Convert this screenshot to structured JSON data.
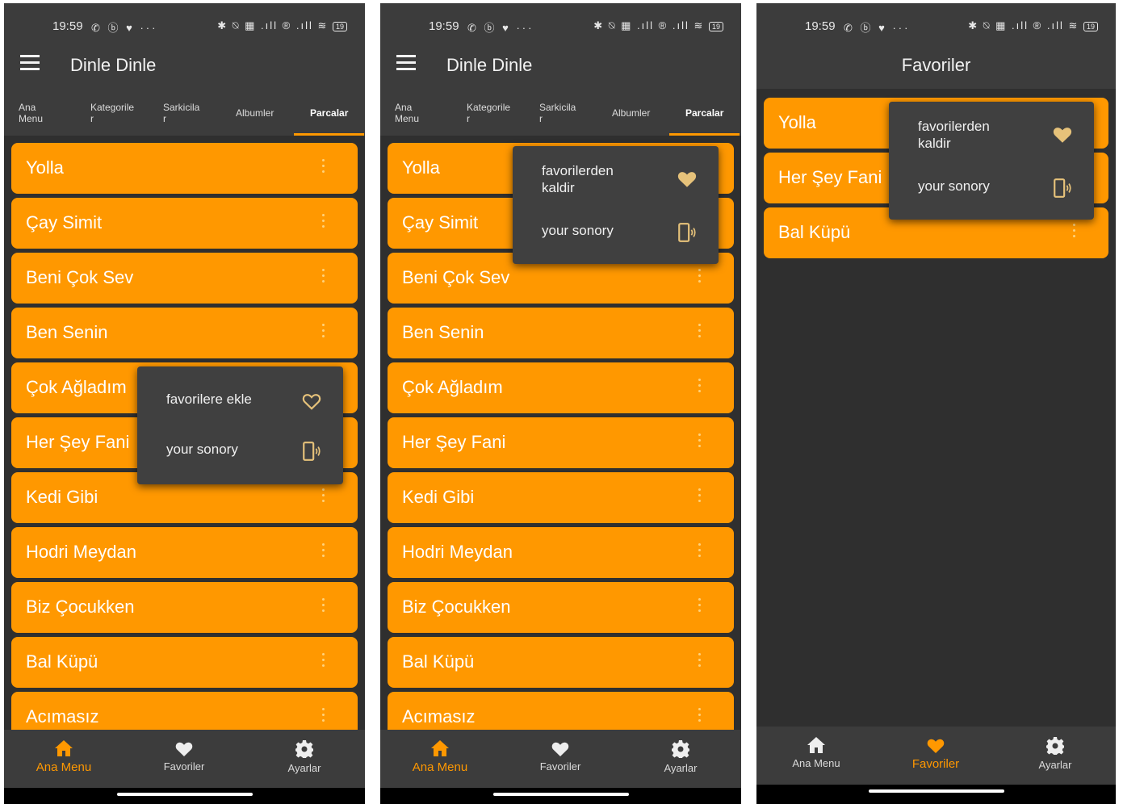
{
  "colors": {
    "accent": "#ff9800",
    "bar": "#3c3c3c",
    "background": "#2f2f2f",
    "popup": "#404040"
  },
  "status": {
    "time": "19:59",
    "left_icons": "✆ ⓑ ♥ ···",
    "right_icons": "✱ ⍉ ▦ .ıll ® .ıll ≋",
    "battery": "19"
  },
  "screen1": {
    "title": "Dinle Dinle",
    "tabs": [
      {
        "line1": "Ana",
        "line2": "Menu"
      },
      {
        "line1": "Kategorile",
        "line2": "r"
      },
      {
        "line1": "Sarkicila",
        "line2": "r"
      },
      {
        "line1": "Albumler",
        "line2": ""
      },
      {
        "line1": "Parcalar",
        "line2": ""
      }
    ],
    "songs": [
      "Yolla",
      "Çay Simit",
      "Beni Çok Sev",
      "Ben Senin",
      "Çok Ağladım",
      "Her Şey Fani",
      "Kedi Gibi",
      "Hodri Meydan",
      "Biz Çocukken",
      "Bal Küpü",
      "Acımasız"
    ],
    "popup": {
      "favorite_label": "favorilere ekle",
      "favorite_icon": "heart-outline-icon",
      "sonory_label": "your sonory",
      "sonory_icon": "phone-sound-icon"
    },
    "nav": [
      {
        "label": "Ana Menu",
        "icon": "home-icon",
        "active": true
      },
      {
        "label": "Favoriler",
        "icon": "heart-icon",
        "active": false
      },
      {
        "label": "Ayarlar",
        "icon": "gear-icon",
        "active": false
      }
    ]
  },
  "screen2": {
    "title": "Dinle Dinle",
    "tabs": [
      {
        "line1": "Ana",
        "line2": "Menu"
      },
      {
        "line1": "Kategorile",
        "line2": "r"
      },
      {
        "line1": "Sarkicila",
        "line2": "r"
      },
      {
        "line1": "Albumler",
        "line2": ""
      },
      {
        "line1": "Parcalar",
        "line2": ""
      }
    ],
    "songs": [
      "Yolla",
      "Çay Simit",
      "Beni Çok Sev",
      "Ben Senin",
      "Çok Ağladım",
      "Her Şey Fani",
      "Kedi Gibi",
      "Hodri Meydan",
      "Biz Çocukken",
      "Bal Küpü",
      "Acımasız"
    ],
    "popup": {
      "favorite_line1": "favorilerden",
      "favorite_line2": "kaldir",
      "favorite_icon": "heart-filled-icon",
      "sonory_label": "your sonory",
      "sonory_icon": "phone-sound-icon"
    },
    "nav": [
      {
        "label": "Ana Menu",
        "icon": "home-icon",
        "active": true
      },
      {
        "label": "Favoriler",
        "icon": "heart-icon",
        "active": false
      },
      {
        "label": "Ayarlar",
        "icon": "gear-icon",
        "active": false
      }
    ]
  },
  "screen3": {
    "title": "Favoriler",
    "songs": [
      "Yolla",
      "Her Şey Fani",
      "Bal Küpü"
    ],
    "popup": {
      "favorite_line1": "favorilerden",
      "favorite_line2": "kaldir",
      "favorite_icon": "heart-filled-icon",
      "sonory_label": "your sonory",
      "sonory_icon": "phone-sound-icon"
    },
    "nav": [
      {
        "label": "Ana Menu",
        "icon": "home-icon",
        "active": false
      },
      {
        "label": "Favoriler",
        "icon": "heart-icon",
        "active": true
      },
      {
        "label": "Ayarlar",
        "icon": "gear-icon",
        "active": false
      }
    ]
  }
}
